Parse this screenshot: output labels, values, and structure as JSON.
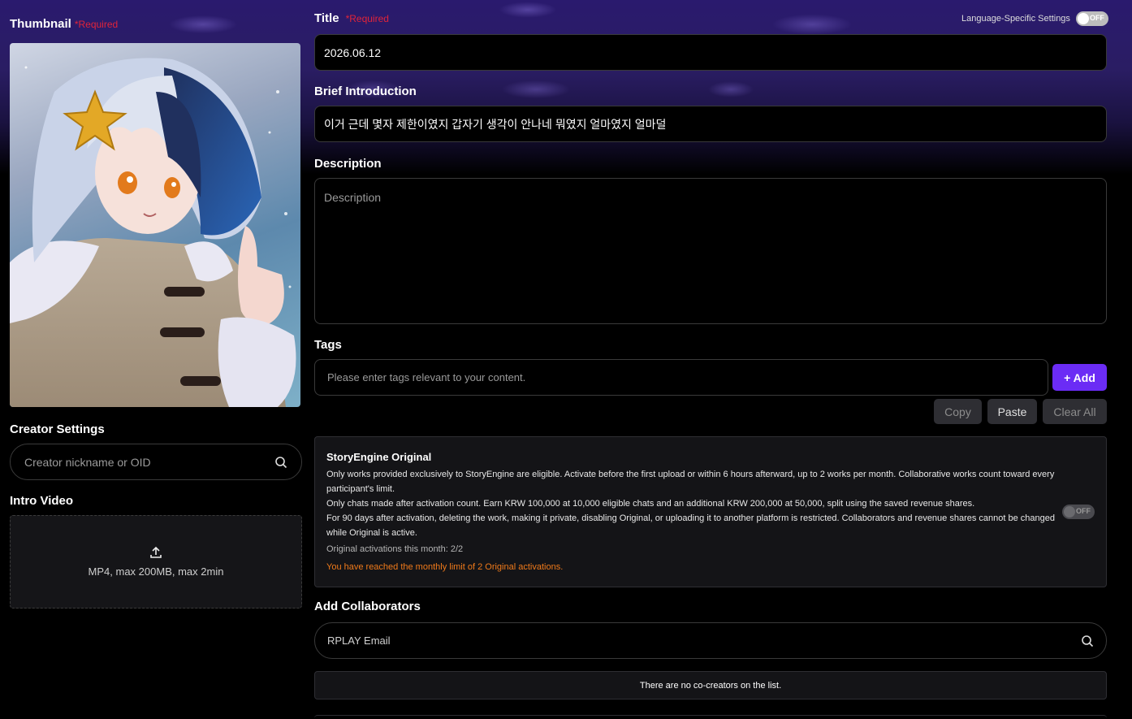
{
  "left": {
    "thumbnail_label": "Thumbnail",
    "thumbnail_required": "*Required",
    "creator_settings_label": "Creator Settings",
    "creator_placeholder": "Creator nickname or OID",
    "intro_video_label": "Intro Video",
    "intro_video_hint": "MP4, max 200MB, max 2min"
  },
  "header": {
    "lang_settings_label": "Language-Specific Settings",
    "lang_toggle_state": "OFF"
  },
  "form": {
    "title_label": "Title",
    "title_required": "*Required",
    "title_value": "2026.06.12",
    "brief_label": "Brief Introduction",
    "brief_value": "이거 근데 몇자 제한이였지 갑자기 생각이 안나네 뭐였지 얼마였지 얼마덜",
    "description_label": "Description",
    "description_placeholder": "Description",
    "tags_label": "Tags",
    "tags_placeholder": "Please enter tags relevant to your content.",
    "add_button": "+ Add",
    "copy_button": "Copy",
    "paste_button": "Paste",
    "clear_button": "Clear All"
  },
  "original": {
    "title": "StoryEngine Original",
    "line1": "Only works provided exclusively to StoryEngine are eligible. Activate before the first upload or within 6 hours afterward, up to 2 works per month. Collaborative works count toward every participant's limit.",
    "line2": "Only chats made after activation count. Earn KRW 100,000 at 10,000 eligible chats and an additional KRW 200,000 at 50,000, split using the saved revenue shares.",
    "line3": "For 90 days after activation, deleting the work, making it private, disabling Original, or uploading it to another platform is restricted. Collaborators and revenue shares cannot be changed while Original is active.",
    "activations": "Original activations this month: 2/2",
    "limit_warning": "You have reached the monthly limit of 2 Original activations.",
    "toggle_state": "OFF"
  },
  "collaborators": {
    "label": "Add Collaborators",
    "placeholder": "RPLAY Email",
    "empty_text": "There are no co-creators on the list."
  },
  "colors": {
    "accent": "#6b2cf5",
    "required": "#e0243a",
    "warning": "#f07a1a"
  }
}
